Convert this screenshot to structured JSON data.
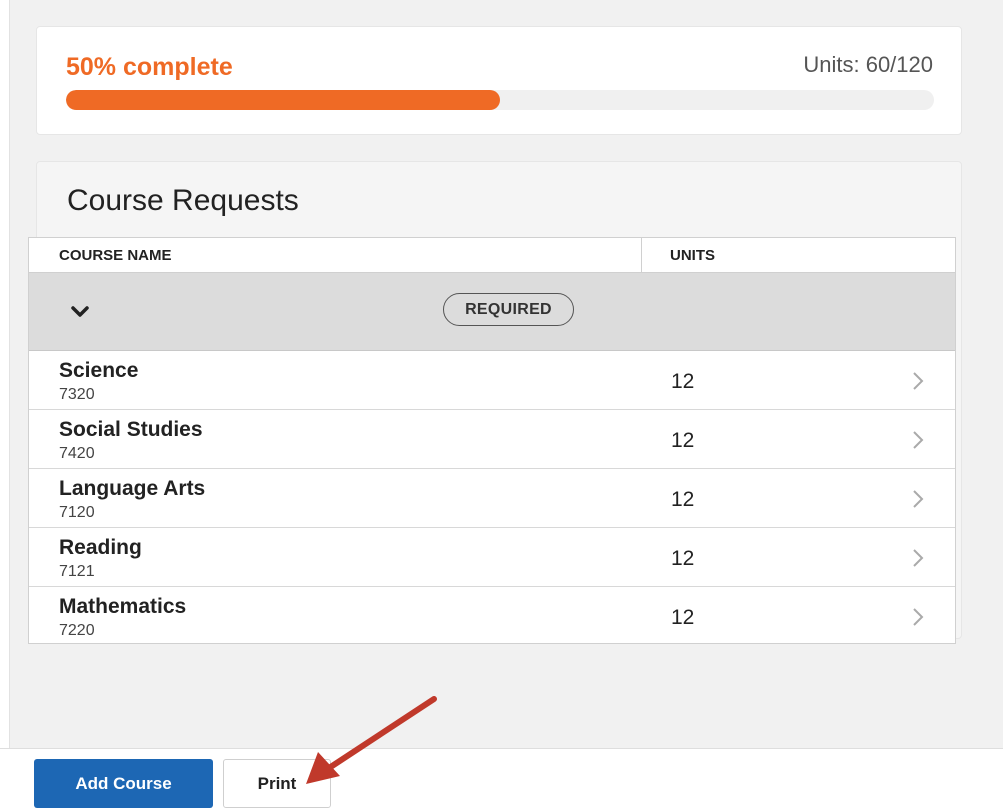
{
  "progress": {
    "label": "50% complete",
    "percent": 50,
    "units_label": "Units: 60/120",
    "color": "#ef6a25"
  },
  "course_requests": {
    "title": "Course Requests",
    "columns": {
      "course_name": "COURSE NAME",
      "units": "UNITS"
    },
    "group": {
      "label": "REQUIRED",
      "icon": "chevron-down-icon"
    },
    "rows": [
      {
        "name": "Science",
        "code": "7320",
        "units": "12"
      },
      {
        "name": "Social Studies",
        "code": "7420",
        "units": "12"
      },
      {
        "name": "Language Arts",
        "code": "7120",
        "units": "12"
      },
      {
        "name": "Reading",
        "code": "7121",
        "units": "12"
      },
      {
        "name": "Mathematics",
        "code": "7220",
        "units": "12"
      }
    ],
    "row_icon": "chevron-right-icon"
  },
  "footer": {
    "add_course_label": "Add Course",
    "print_label": "Print",
    "primary_color": "#1d67b4"
  },
  "annotation": {
    "icon": "arrow-icon",
    "color": "#c0392b"
  }
}
